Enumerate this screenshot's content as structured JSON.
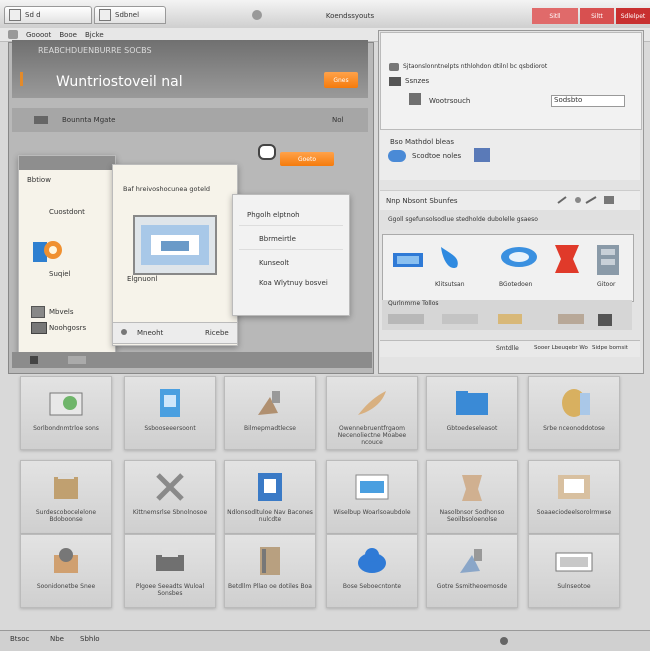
{
  "window": {
    "tabs": [
      {
        "label": "Sd d"
      },
      {
        "label": "Sdbnel"
      },
      {
        "label": "Sdbeke"
      }
    ],
    "title": "Koendssyouts",
    "window_buttons": [
      "Sitll",
      "Siltt",
      "Sdlelpet"
    ]
  },
  "toolbar": {
    "items": [
      "Goooot",
      "Booe",
      "Bjcke"
    ]
  },
  "hero": {
    "subtitle": "REABCHDUENBURRE SOCBS",
    "title": "Wuntriostoveil nal",
    "button": "Gnes"
  },
  "nav": {
    "label": "Bounnta Mgate",
    "right": "Nol"
  },
  "left_card": {
    "header": "Bbtiow",
    "item1": "Cuostdont",
    "item2": "Suqiel",
    "item3": "Mbvels",
    "item4": "Noohgosrs"
  },
  "middle_card": {
    "header": "Baf hreivoshocunea goteld",
    "caption": "Elgnuonl",
    "button1": "Mneoht",
    "button2": "Ricebe"
  },
  "popup": {
    "items": [
      "Phgolh elptnoh",
      "Bbrmeirtle",
      "Kunseolt",
      "Koa Wlytnuy bosvei"
    ],
    "button": "Goeto"
  },
  "right": {
    "top_text": "Sjtaonslonntnelpts nthlohdon dtilnl bc qsbdiorot",
    "row1": "Ssnzes",
    "row2": "Wootrsouch",
    "row2_value": "Sodsbto",
    "section_title": "Bso Mathdol bleas",
    "section_sub": "Scodtoe noles",
    "list_header": "Nnp Nbsont Sbunfes",
    "list_sub": "Ggoll sgefunsolsodlue stedholde dubolelle gsaeso",
    "strip_labels": [
      "Klitsutsan",
      "BGotedoen",
      "Gitoor"
    ],
    "footer_label": "Qurlnmrne Tollos",
    "footer_buttons": [
      "Smtdlle",
      "Sooer Lbeuqebr Wodt",
      "Sidpe bomsit"
    ]
  },
  "grid": [
    {
      "label": "Sorlbondnmtrloe sons",
      "icon": "photo-icon",
      "color": "#6fb56a"
    },
    {
      "label": "Ssbooseeersoont",
      "icon": "document-icon",
      "color": "#4a9fe0"
    },
    {
      "label": "Bilmepmadtlecse",
      "icon": "tools-icon",
      "color": "#b09070"
    },
    {
      "label": "Owennebruentfrgaom Necenoliectne Moabee ncouce",
      "icon": "feather-icon",
      "color": "#d8b080"
    },
    {
      "label": "Gbtoedeseleasot",
      "icon": "folder-icon",
      "color": "#3a8ad6"
    },
    {
      "label": "Srbe nceonoddotose",
      "icon": "egg-icon",
      "color": "#d8b060"
    },
    {
      "label": "Surdescobocelelone Bdoboonse",
      "icon": "box-icon",
      "color": "#c0a070"
    },
    {
      "label": "Kittnemsrlse Sbnolnosoe",
      "icon": "scissors-icon",
      "color": "#8a8a8a"
    },
    {
      "label": "Ndlonsodltuloe Nav Bacones nulcdte",
      "icon": "clipboard-icon",
      "color": "#3a7ac6"
    },
    {
      "label": "Wiselbup Woarlsoaubdole",
      "icon": "window-icon",
      "color": "#4a9fe0"
    },
    {
      "label": "Nasolbnsor Sodhonso Seoilbsoloenolse",
      "icon": "chair-icon",
      "color": "#d0b090"
    },
    {
      "label": "Soaaeciodeelsorolrmwse",
      "icon": "frame-icon",
      "color": "#d8c0a0"
    },
    {
      "label": "Soonidonetbe Snee",
      "icon": "camera-icon",
      "color": "#d0a070"
    },
    {
      "label": "Plgoee Seeadts Wuloal Sonsbes",
      "icon": "printer-icon",
      "color": "#707070"
    },
    {
      "label": "Betdllm Pllao oe dotiles Boa",
      "icon": "book-icon",
      "color": "#b8a080"
    },
    {
      "label": "Bose Seboecntonte",
      "icon": "cloud-icon",
      "color": "#2f7ad6"
    },
    {
      "label": "Gotre Ssmitheoemosde",
      "icon": "tools-icon",
      "color": "#8aa6c8"
    },
    {
      "label": "Sulnseotoe",
      "icon": "keyboard-icon",
      "color": "#c8c8c8"
    }
  ],
  "status": {
    "items": [
      "Btsoc",
      "Nbe",
      "Sbhlo"
    ]
  }
}
